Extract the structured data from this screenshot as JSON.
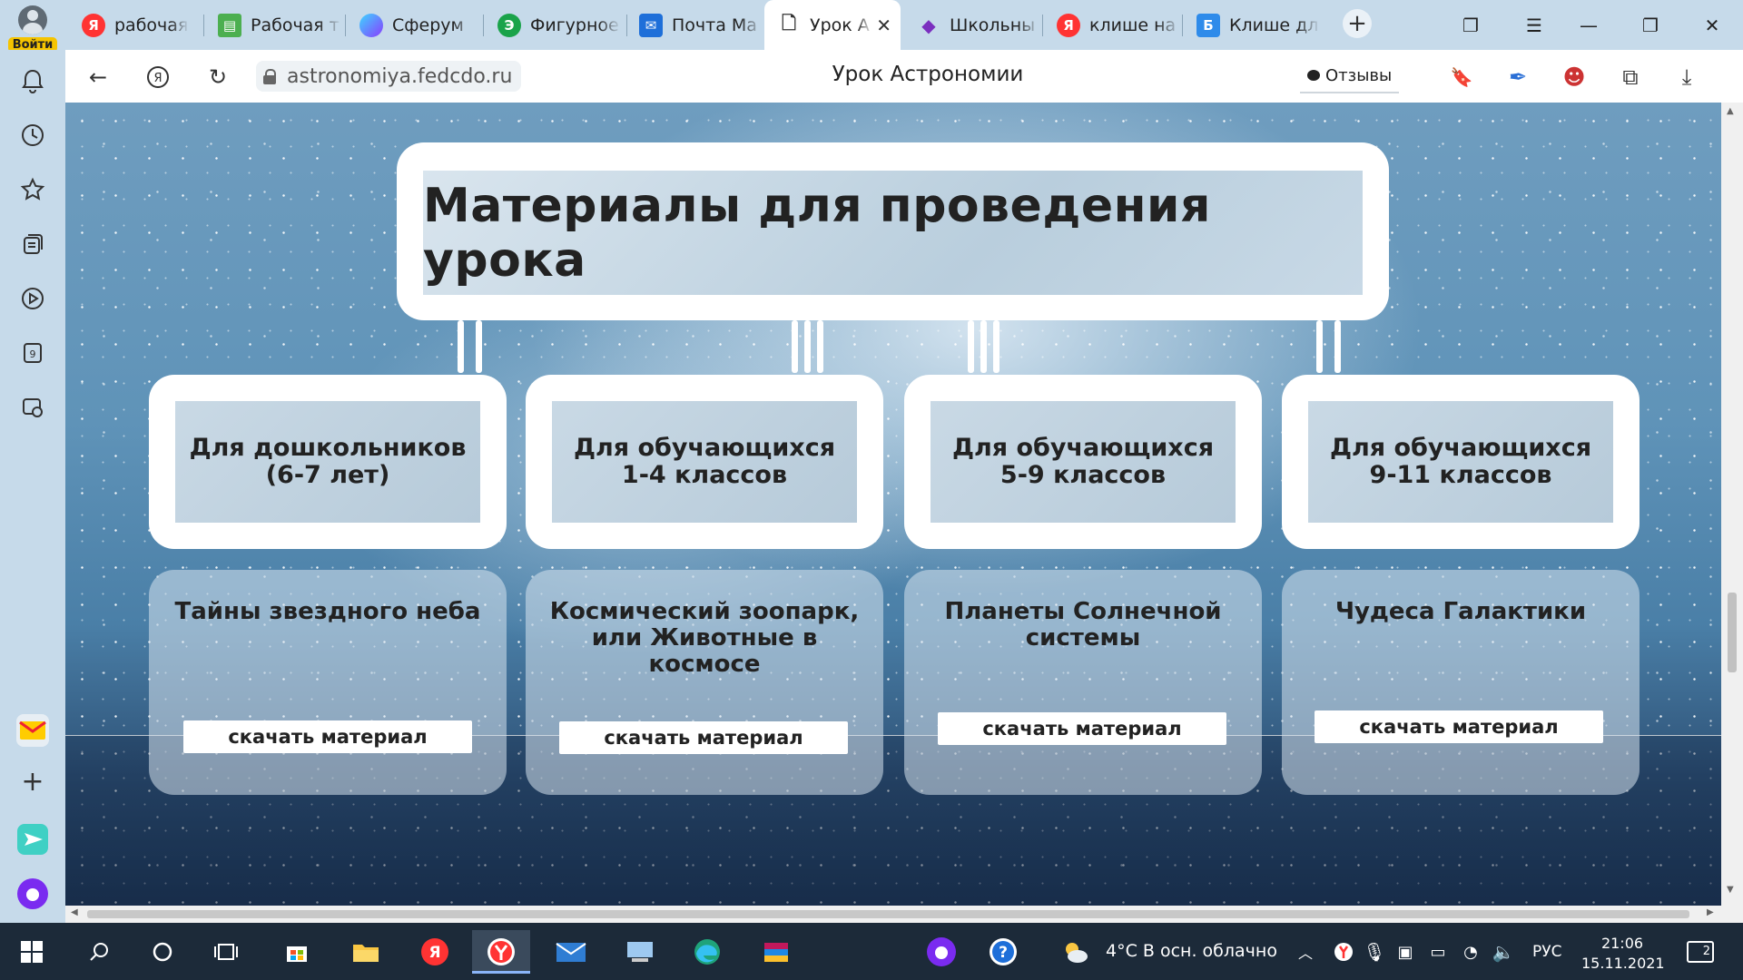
{
  "browser": {
    "profile_label": "Войти",
    "tabs": [
      {
        "label": "рабочая т",
        "icon": "yandex-icon",
        "color": "#f33"
      },
      {
        "label": "Рабочая т",
        "icon": "book-icon",
        "color": "#4caf50"
      },
      {
        "label": "Сферум",
        "icon": "sferum-icon",
        "color": "#6a4cff"
      },
      {
        "label": "Фигурное",
        "icon": "green-circle-icon",
        "color": "#1aa34a"
      },
      {
        "label": "Почта Ма",
        "icon": "mail-icon",
        "color": "#1e6fd9"
      },
      {
        "label": "Урок А",
        "icon": "page-icon",
        "color": "#ffffff"
      },
      {
        "label": "Школьны",
        "icon": "diamond-icon",
        "color": "#7b2fbf"
      },
      {
        "label": "клише на",
        "icon": "yandex-icon",
        "color": "#f33"
      },
      {
        "label": "Клише дл",
        "icon": "b-icon",
        "color": "#2e8bea"
      }
    ],
    "active_tab_close": "✕",
    "new_tab": "+",
    "url": "astronomiya.fedcdo.ru",
    "title": "Урок Астрономии",
    "reviews_label": "Отзывы"
  },
  "content": {
    "main_title": "Материалы для проведения урока",
    "categories": [
      {
        "label": "Для дошкольников\n(6-7 лет)"
      },
      {
        "label": "Для обучающихся\n1-4 классов"
      },
      {
        "label": "Для обучающихся\n5-9 классов"
      },
      {
        "label": "Для обучающихся\n9-11 классов"
      }
    ],
    "topics": [
      {
        "title": "Тайны звездного неба",
        "download": "скачать материал"
      },
      {
        "title": "Космический зоопарк, или Животные в космосе",
        "download": "скачать материал"
      },
      {
        "title": "Планеты Солнечной системы",
        "download": "скачать материал"
      },
      {
        "title": "Чудеса Галактики",
        "download": "скачать материал"
      }
    ]
  },
  "taskbar": {
    "weather": "4°C  В осн. облачно",
    "language": "РУС",
    "time": "21:06",
    "date": "15.11.2021",
    "notifications": "2"
  }
}
